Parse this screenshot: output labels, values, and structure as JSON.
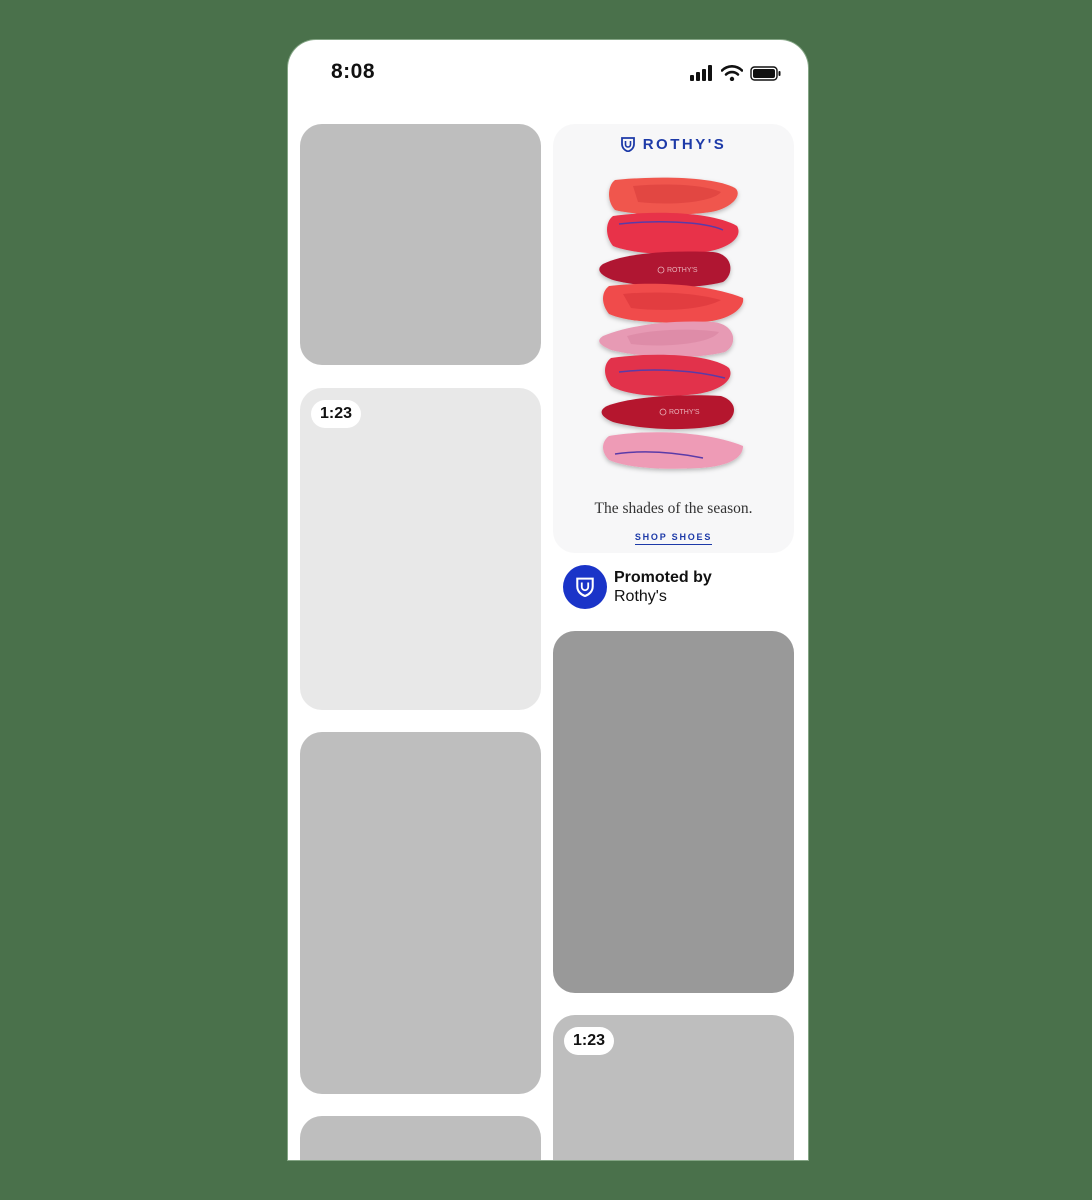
{
  "status_bar": {
    "time": "8:08",
    "icons": [
      "cellular-signal-icon",
      "wifi-icon",
      "battery-icon"
    ]
  },
  "feed": {
    "video_badge": "1:23"
  },
  "ad": {
    "brand": "ROTHY'S",
    "tagline": "The shades of the season.",
    "cta": "SHOP SHOES",
    "promoted_label": "Promoted by",
    "advertiser": "Rothy's",
    "shoe_label": "ROTHY'S",
    "brand_color": "#1d3aa8",
    "avatar_color": "#1a34c8"
  },
  "colors": {
    "background": "#4a714b",
    "placeholder_mid": "#bebebe",
    "placeholder_light": "#e8e8e8",
    "placeholder_dark": "#999999"
  }
}
